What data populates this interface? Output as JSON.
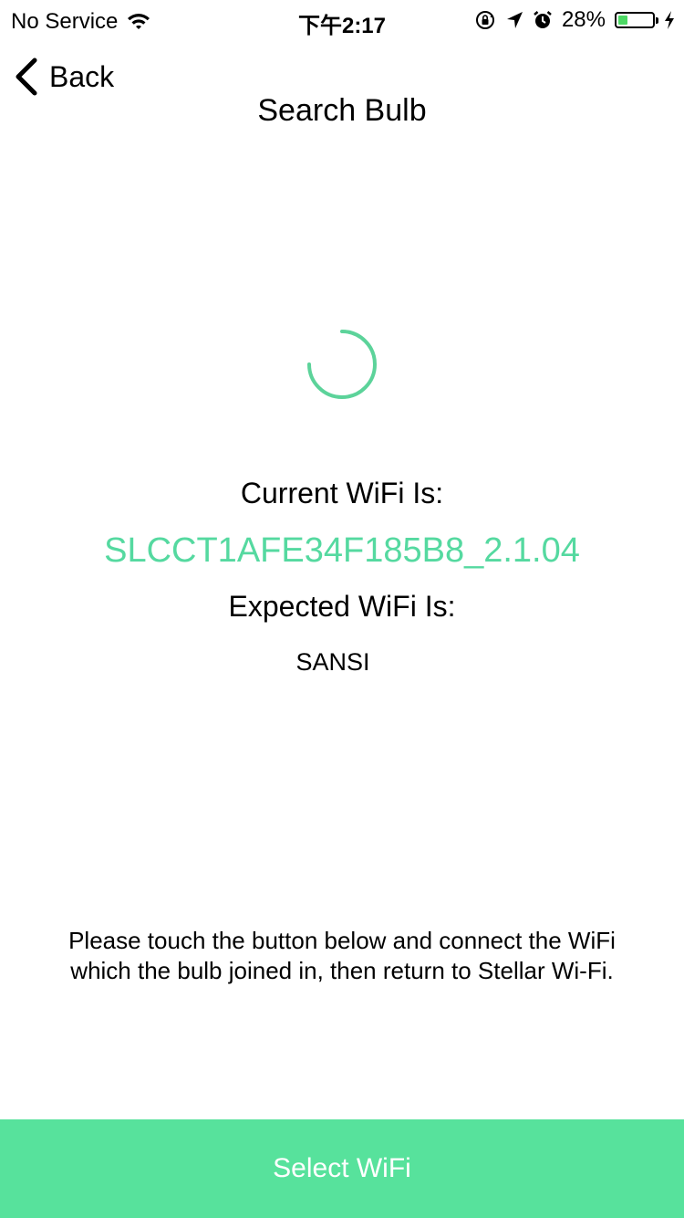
{
  "status_bar": {
    "carrier": "No Service",
    "time": "下午2:17",
    "battery_percent": "28%",
    "battery_level": 0.28,
    "icons": [
      "wifi-icon",
      "orientation-lock-icon",
      "location-arrow-icon",
      "alarm-icon",
      "battery-icon",
      "charging-bolt-icon"
    ]
  },
  "nav": {
    "back_label": "Back",
    "title": "Search Bulb"
  },
  "wifi": {
    "current_label": "Current WiFi Is:",
    "current_ssid": "SLCCT1AFE34F185B8_2.1.04",
    "expected_label": "Expected WiFi Is:",
    "expected_ssid": "SANSI"
  },
  "instructions": "Please touch the button below and connect the WiFi which the bulb joined in, then return to Stellar Wi-Fi.",
  "button": {
    "label": "Select WiFi"
  },
  "colors": {
    "accent": "#57e29c",
    "ssid_text": "#55d9a0",
    "spinner": "#5cd39a"
  }
}
